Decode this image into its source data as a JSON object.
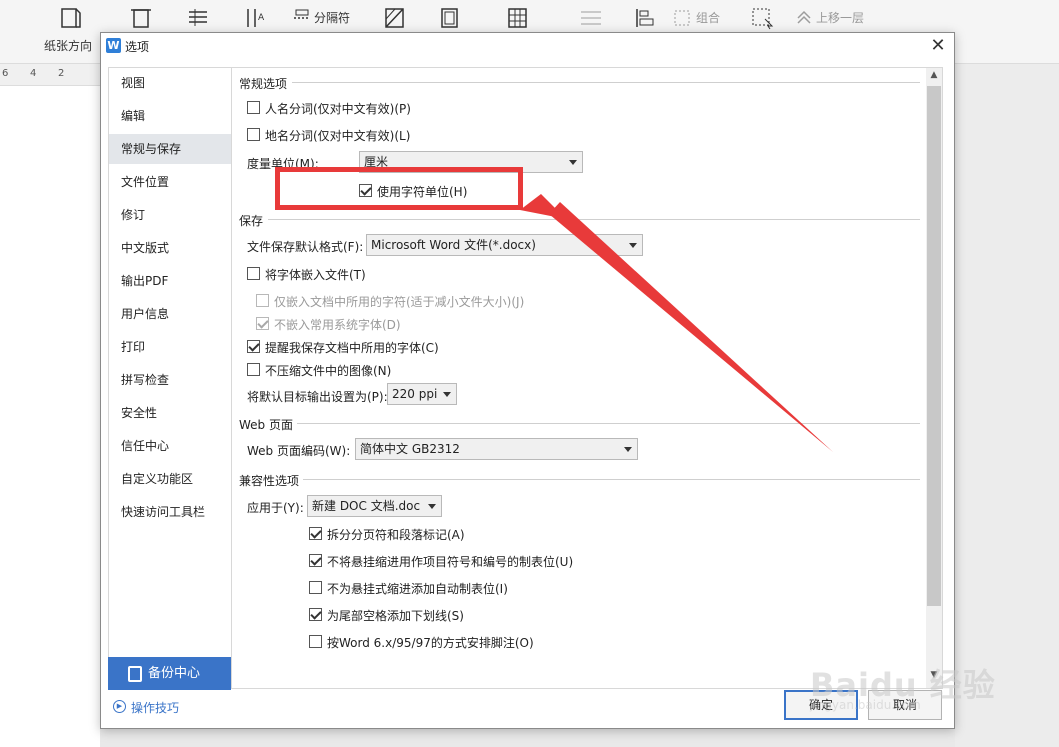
{
  "toolbar": {
    "orientation_label": "纸张方向",
    "separator_label": "分隔符",
    "group_label": "组合",
    "bring_forward_label": "上移一层"
  },
  "ruler": {
    "ticks": [
      "6",
      "4",
      "2"
    ]
  },
  "dialog": {
    "title": "选项",
    "nav": [
      "视图",
      "编辑",
      "常规与保存",
      "文件位置",
      "修订",
      "中文版式",
      "输出PDF",
      "用户信息",
      "打印",
      "拼写检查",
      "安全性",
      "信任中心",
      "自定义功能区",
      "快速访问工具栏"
    ],
    "nav_selected_index": 2,
    "backup_label": "备份中心",
    "tips_label": "操作技巧",
    "ok_label": "确定",
    "cancel_label": "取消",
    "sections": {
      "general": {
        "title": "常规选项",
        "person_name_seg": "人名分词(仅对中文有效)(P)",
        "place_name_seg": "地名分词(仅对中文有效)(L)",
        "unit_label": "度量单位(M):",
        "unit_value": "厘米",
        "use_char_unit": "使用字符单位(H)"
      },
      "save": {
        "title": "保存",
        "default_format_label": "文件保存默认格式(F):",
        "default_format_value": "Microsoft Word 文件(*.docx)",
        "embed_fonts": "将字体嵌入文件(T)",
        "embed_used_only": "仅嵌入文档中所用的字符(适于减小文件大小)(J)",
        "no_common_fonts": "不嵌入常用系统字体(D)",
        "remind_fonts": "提醒我保存文档中所用的字体(C)",
        "no_compress": "不压缩文件中的图像(N)",
        "output_label": "将默认目标输出设置为(P):",
        "output_value": "220 ppi"
      },
      "web": {
        "title": "Web 页面",
        "encoding_label": "Web 页面编码(W):",
        "encoding_value": "简体中文 GB2312"
      },
      "compat": {
        "title": "兼容性选项",
        "apply_label": "应用于(Y):",
        "apply_value": "新建 DOC 文档.doc",
        "opt1": "拆分分页符和段落标记(A)",
        "opt2": "不将悬挂缩进用作项目符号和编号的制表位(U)",
        "opt3": "不为悬挂式缩进添加自动制表位(I)",
        "opt4": "为尾部空格添加下划线(S)",
        "opt5": "按Word 6.x/95/97的方式安排脚注(O)"
      }
    }
  },
  "watermark": {
    "text": "Baidu 经验",
    "sub": "jingyan.baidu.com"
  },
  "colors": {
    "accent": "#3a74c8",
    "annotation": "#e83a3a"
  }
}
